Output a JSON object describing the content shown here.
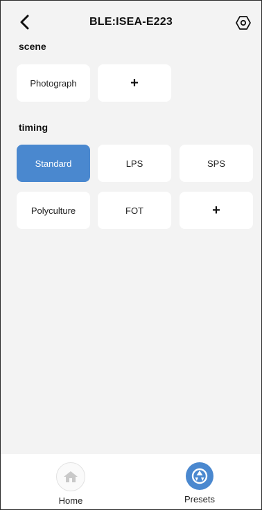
{
  "header": {
    "title": "BLE:ISEA-E223",
    "back_icon": "chevron-left-icon",
    "settings_icon": "hexagon-settings-icon"
  },
  "scene": {
    "label": "scene",
    "items": [
      {
        "label": "Photograph",
        "selected": false
      },
      {
        "label": "+",
        "type": "add"
      }
    ]
  },
  "timing": {
    "label": "timing",
    "items": [
      {
        "label": "Standard",
        "selected": true
      },
      {
        "label": "LPS",
        "selected": false
      },
      {
        "label": "SPS",
        "selected": false
      },
      {
        "label": "Polyculture",
        "selected": false
      },
      {
        "label": "FOT",
        "selected": false
      },
      {
        "label": "+",
        "type": "add"
      }
    ]
  },
  "bottom_nav": {
    "items": [
      {
        "label": "Home",
        "icon": "home-icon",
        "active": false
      },
      {
        "label": "Presets",
        "icon": "presets-icon",
        "active": true
      }
    ]
  },
  "colors": {
    "accent": "#4a88cf",
    "background": "#f3f3f3",
    "tile": "#ffffff"
  }
}
